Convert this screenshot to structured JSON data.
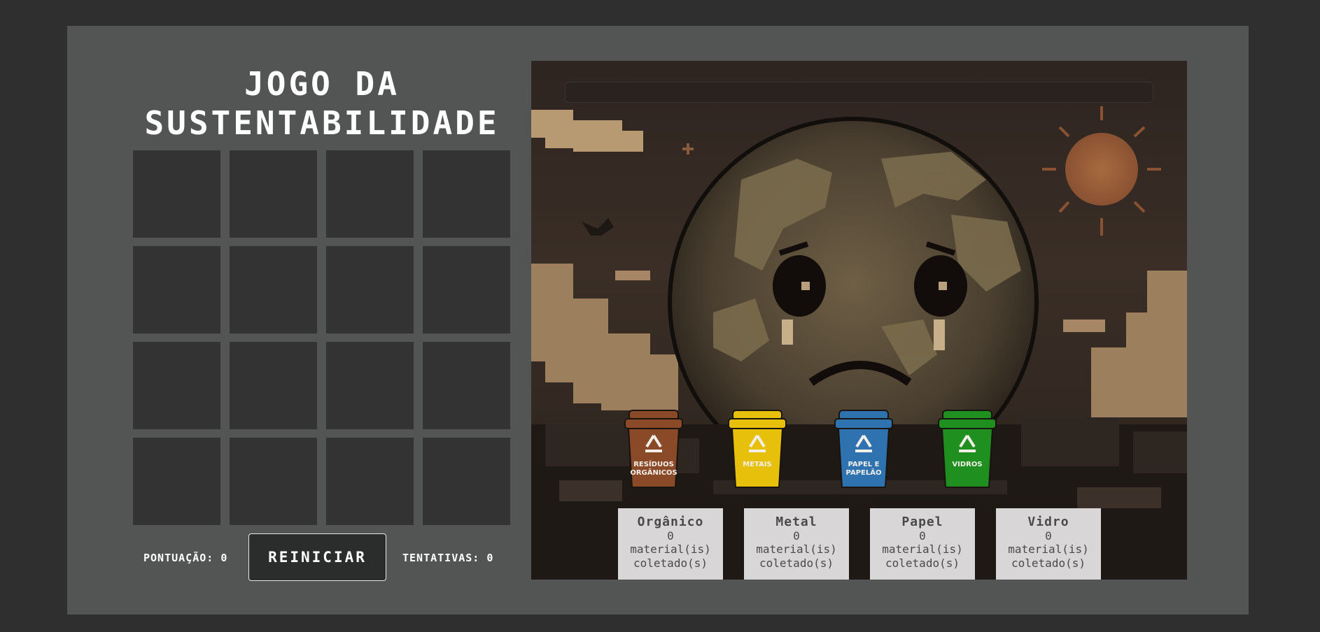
{
  "title": {
    "line1": "JOGO DA",
    "line2": "SUSTENTABILIDADE"
  },
  "board": {
    "cards": [
      "",
      "",
      "",
      "",
      "",
      "",
      "",
      "",
      "",
      "",
      "",
      "",
      "",
      "",
      "",
      ""
    ]
  },
  "controls": {
    "score_label": "PONTUAÇÃO: 0",
    "restart_label": "REINICIAR",
    "attempts_label": "TENTATIVAS: 0"
  },
  "progress": {
    "fraction": 0
  },
  "bins": [
    {
      "name": "Orgânico",
      "count": "0",
      "line1": "material(is)",
      "line2": "coletado(s)",
      "bin_text_1": "RESÍDUOS",
      "bin_text_2": "ORGÂNICOS",
      "color": "#8a4a28"
    },
    {
      "name": "Metal",
      "count": "0",
      "line1": "material(is)",
      "line2": "coletado(s)",
      "bin_text_1": "METAIS",
      "bin_text_2": "",
      "color": "#e6c00a"
    },
    {
      "name": "Papel",
      "count": "0",
      "line1": "material(is)",
      "line2": "coletado(s)",
      "bin_text_1": "PAPEL E",
      "bin_text_2": "PAPELÃO",
      "color": "#2e73b0"
    },
    {
      "name": "Vidro",
      "count": "0",
      "line1": "material(is)",
      "line2": "coletado(s)",
      "bin_text_1": "VIDROS",
      "bin_text_2": "",
      "color": "#1f8f1f"
    }
  ],
  "icons": {
    "recycle": "recycle-icon",
    "earth": "sad-earth-illustration",
    "sun": "sun-icon",
    "bird": "bird-icon"
  }
}
